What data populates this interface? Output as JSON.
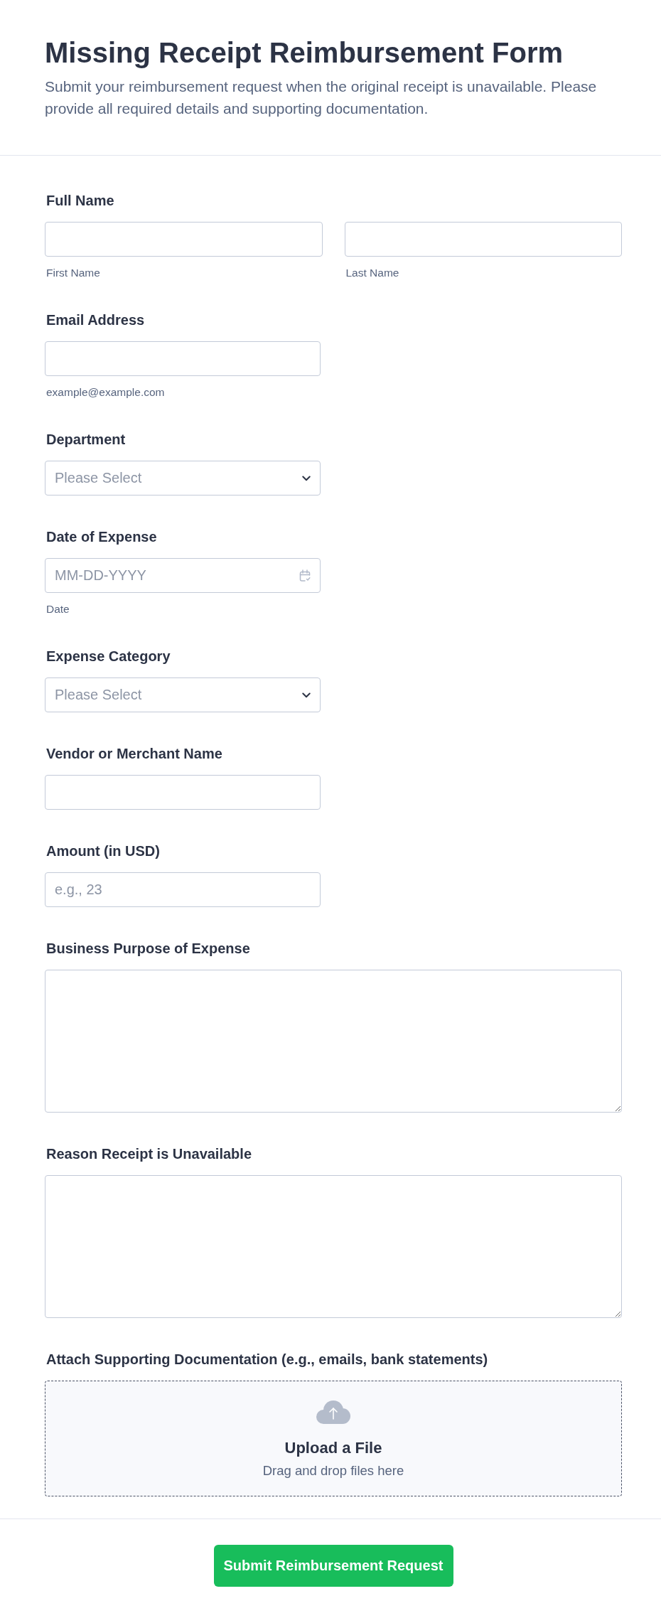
{
  "header": {
    "title": "Missing Receipt Reimbursement Form",
    "description": "Submit your reimbursement request when the original receipt is unavailable. Please provide all required details and supporting documentation."
  },
  "fields": [
    {
      "kind": "name",
      "label": "Full Name",
      "inputs": [
        {
          "sublabel": "First Name"
        },
        {
          "sublabel": "Last Name"
        }
      ]
    },
    {
      "kind": "text",
      "label": "Email Address",
      "sublabel": "example@example.com"
    },
    {
      "kind": "select",
      "label": "Department",
      "placeholder": "Please Select"
    },
    {
      "kind": "date",
      "label": "Date of Expense",
      "placeholder": "MM-DD-YYYY",
      "sublabel": "Date"
    },
    {
      "kind": "select",
      "label": "Expense Category",
      "placeholder": "Please Select"
    },
    {
      "kind": "text",
      "label": "Vendor or Merchant Name"
    },
    {
      "kind": "text",
      "label": "Amount (in USD)",
      "placeholder": "e.g., 23"
    },
    {
      "kind": "textarea",
      "label": "Business Purpose of Expense"
    },
    {
      "kind": "textarea",
      "label": "Reason Receipt is Unavailable"
    },
    {
      "kind": "upload",
      "label": "Attach Supporting Documentation (e.g., emails, bank statements)",
      "title": "Upload a File",
      "hint": "Drag and drop files here"
    }
  ],
  "submit": {
    "label": "Submit Reimbursement Request"
  }
}
